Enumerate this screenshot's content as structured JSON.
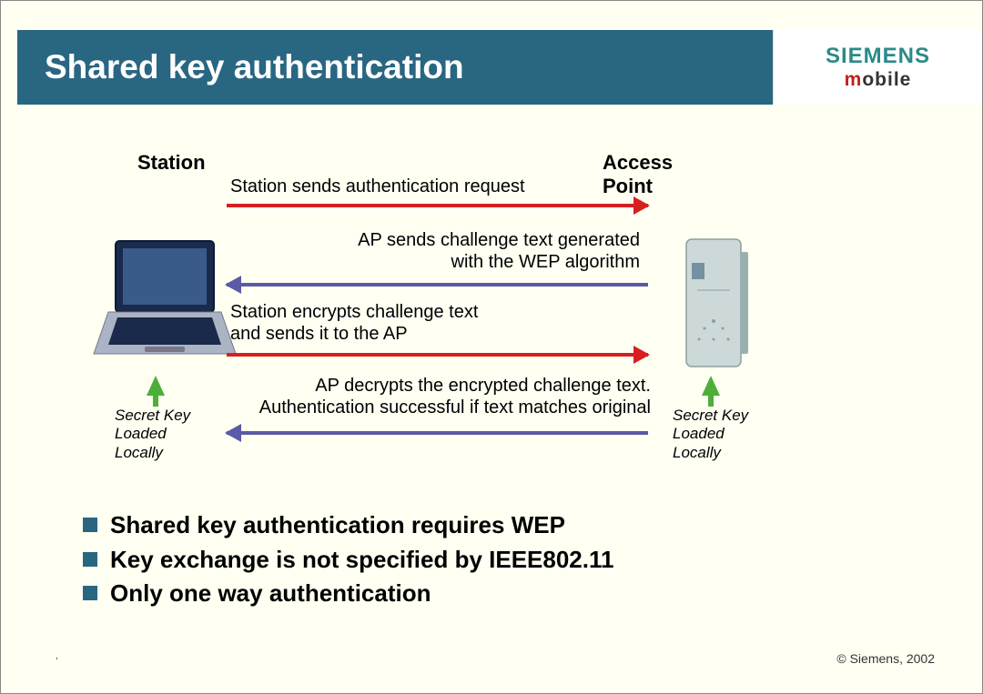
{
  "title": "Shared key authentication",
  "logo": {
    "brand": "SIEMENS",
    "sub_m": "m",
    "sub_rest": "obile"
  },
  "diagram": {
    "station_label": "Station",
    "ap_label_1": "Access",
    "ap_label_2": "Point",
    "key_caption_1": "Secret Key",
    "key_caption_2": "Loaded",
    "key_caption_3": "Locally",
    "messages": {
      "m1": "Station sends authentication request",
      "m2a": "AP sends challenge text generated",
      "m2b": "with the WEP algorithm",
      "m3a": "Station encrypts challenge text",
      "m3b": "and sends it to the AP",
      "m4a": "AP decrypts the encrypted challenge text.",
      "m4b": "Authentication successful if text matches original"
    }
  },
  "bullets": [
    "Shared key authentication requires WEP",
    "Key exchange is not specified by IEEE802.11",
    "Only one way authentication"
  ],
  "footer": {
    "left": ",",
    "right": "© Siemens, 2002"
  }
}
